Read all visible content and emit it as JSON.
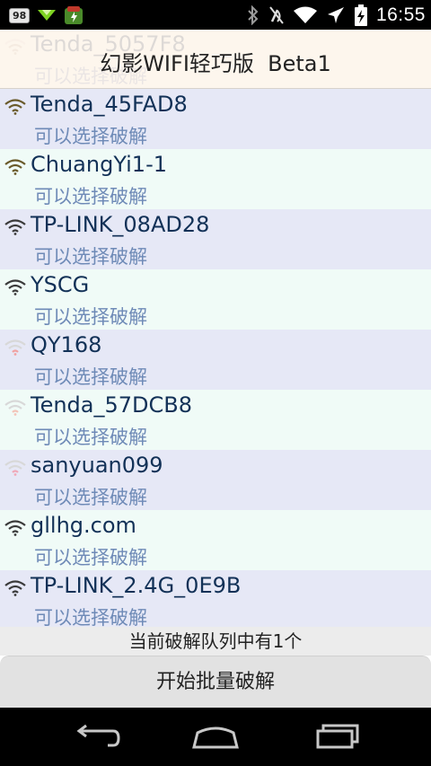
{
  "status_bar": {
    "badge": "98",
    "time": "16:55",
    "icons": [
      "notification-badge-icon",
      "download-arrow-icon",
      "shield-app-icon",
      "bluetooth-icon",
      "mute-icon",
      "wifi-icon",
      "airplane-icon",
      "battery-charging-icon"
    ]
  },
  "app": {
    "title": "幻影WIFI轻巧版  Beta1"
  },
  "networks": [
    {
      "ssid": "Tenda_5057F8",
      "status": "可以选择破解",
      "signal": "medium",
      "color": "#b8b0a0"
    },
    {
      "ssid": "Tenda_45FAD8",
      "status": "可以选择破解",
      "signal": "strong",
      "color": "#6a5a2a"
    },
    {
      "ssid": "ChuangYi1-1",
      "status": "可以选择破解",
      "signal": "strong",
      "color": "#6a5a2a"
    },
    {
      "ssid": "TP-LINK_08AD28",
      "status": "可以选择破解",
      "signal": "strong",
      "color": "#3a3a3a"
    },
    {
      "ssid": "YSCG",
      "status": "可以选择破解",
      "signal": "strong",
      "color": "#3a3a3a"
    },
    {
      "ssid": "QY168",
      "status": "可以选择破解",
      "signal": "weak",
      "color": "#f0a0a0"
    },
    {
      "ssid": "Tenda_57DCB8",
      "status": "可以选择破解",
      "signal": "weak",
      "color": "#f3c3b8"
    },
    {
      "ssid": "sanyuan099",
      "status": "可以选择破解",
      "signal": "weak",
      "color": "#f0a8b8"
    },
    {
      "ssid": "gllhg.com",
      "status": "可以选择破解",
      "signal": "strong",
      "color": "#3a3a3a"
    },
    {
      "ssid": "TP-LINK_2.4G_0E9B",
      "status": "可以选择破解",
      "signal": "strong",
      "color": "#3a3a3a"
    }
  ],
  "footer": {
    "queue_text": "当前破解队列中有1个",
    "start_button": "开始批量破解"
  },
  "nav": {
    "icons": [
      "back-icon",
      "home-icon",
      "recent-apps-icon"
    ]
  }
}
